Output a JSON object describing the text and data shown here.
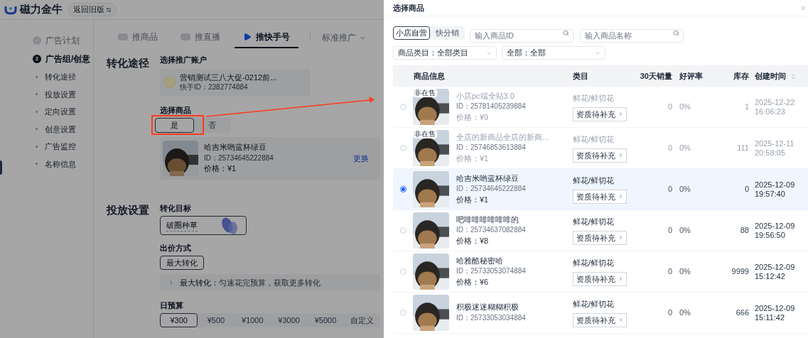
{
  "header": {
    "brand": "磁力金牛",
    "back_button": "返回旧版"
  },
  "sidebar": [
    {
      "label": "广告计划",
      "kind": "done",
      "selected": false
    },
    {
      "label": "广告组/创意",
      "kind": "step",
      "step": "2",
      "selected": true,
      "children": [
        {
          "label": "转化途径"
        },
        {
          "label": "投放设置"
        },
        {
          "label": "定向设置"
        },
        {
          "label": "创意设置"
        },
        {
          "label": "广告监控"
        },
        {
          "label": "名称信息"
        }
      ]
    }
  ],
  "tabs": [
    {
      "label": "推商品",
      "selected": false
    },
    {
      "label": "推直播",
      "selected": false
    },
    {
      "label": "推快手号",
      "selected": true
    }
  ],
  "mode_dropdown": {
    "label": "标准推广"
  },
  "conversion_path": {
    "title": "转化途径",
    "account_label": "选择推广账户",
    "account": {
      "name": "营销测试三八大促-0212前...",
      "id": "快手ID：2382774884"
    },
    "product_label": "选择商品",
    "product_toggle": [
      {
        "label": "是",
        "selected": true
      },
      {
        "label": "否",
        "selected": false
      }
    ],
    "product": {
      "name": "哈吉米哟蓝杯绿豆",
      "id": "ID：25734645222884",
      "price": "价格：¥1",
      "change_link": "更换"
    }
  },
  "delivery": {
    "title": "投放设置",
    "goal_label": "转化目标",
    "goal": "破圈种草",
    "bid_label": "出价方式",
    "bid_options": [
      {
        "label": "最大转化",
        "selected": true
      }
    ],
    "bid_tip_term": "最大转化：",
    "bid_tip": "匀速花完预算，获取更多转化",
    "budget_label": "日预算",
    "budget_options": [
      {
        "label": "¥300",
        "selected": true
      },
      {
        "label": "¥500",
        "selected": false
      },
      {
        "label": "¥1000",
        "selected": false
      },
      {
        "label": "¥3000",
        "selected": false
      },
      {
        "label": "¥5000",
        "selected": false
      },
      {
        "label": "自定义",
        "selected": false
      }
    ]
  },
  "drawer": {
    "title": "选择商品",
    "source_tabs": [
      {
        "label": "小店自营",
        "selected": true
      },
      {
        "label": "快分销",
        "selected": false
      }
    ],
    "id_search": {
      "placeholder": "输入商品ID"
    },
    "name_search": {
      "placeholder": "输入商品名称"
    },
    "category_select": "商品类目：全部类目",
    "status_select": "全部：全部",
    "columns": [
      {
        "label": "商品信息",
        "sortable": false
      },
      {
        "label": "类目",
        "sortable": false
      },
      {
        "label": "30天销量",
        "sortable": false
      },
      {
        "label": "好评率",
        "sortable": false
      },
      {
        "label": "库存",
        "sortable": false
      },
      {
        "label": "创建时间",
        "sortable": true
      }
    ],
    "rows": [
      {
        "selected": false,
        "disabled": true,
        "badge": "非在售",
        "name": "小店pc端全站3.0",
        "id": "ID：25781405239884",
        "price": "价格：¥9",
        "category": "鲜花/鲜切花",
        "qualification": "资质待补充",
        "sales": "0",
        "rating": "0%",
        "stock": "1",
        "created_date": "2025-12-22",
        "created_time": "16:06:23"
      },
      {
        "selected": false,
        "disabled": true,
        "badge": "非在售",
        "name": "全店的新商品全店的新商...",
        "id": "ID：25746853613884",
        "price": "价格：¥1",
        "category": "鲜花/鲜切花",
        "qualification": "资质待补充",
        "sales": "0",
        "rating": "0%",
        "stock": "111",
        "created_date": "2025-12-11",
        "created_time": "20:58:05"
      },
      {
        "selected": true,
        "disabled": false,
        "name": "哈吉米哟蓝杯绿豆",
        "id": "ID：25734645222884",
        "price": "价格：¥1",
        "category": "鲜花/鲜切花",
        "qualification": "资质待补充",
        "sales": "0",
        "rating": "0%",
        "stock": "0",
        "created_date": "2025-12-09",
        "created_time": "19:57:40"
      },
      {
        "selected": false,
        "disabled": false,
        "name": "吧啡啡啡啡啡啡的",
        "id": "ID：25734637082884",
        "price": "价格：¥8",
        "category": "鲜花/鲜切花",
        "qualification": "资质待补充",
        "sales": "0",
        "rating": "0%",
        "stock": "88",
        "created_date": "2025-12-09",
        "created_time": "19:56:50"
      },
      {
        "selected": false,
        "disabled": false,
        "name": "哈雅酷秘密哈",
        "id": "ID：25733053074884",
        "price": "价格：¥6",
        "category": "鲜花/鲜切花",
        "qualification": "资质待补充",
        "sales": "0",
        "rating": "0%",
        "stock": "9999",
        "created_date": "2025-12-09",
        "created_time": "15:12:42"
      },
      {
        "selected": false,
        "disabled": false,
        "name": "积极迷迷糊糊积极",
        "id": "ID：25733053034884",
        "category": "鲜花/鲜切花",
        "qualification": "资质待补充",
        "sales": "0",
        "rating": "0%",
        "stock": "666",
        "created_date": "2025-12-09",
        "created_time": "15:11:42"
      }
    ]
  }
}
